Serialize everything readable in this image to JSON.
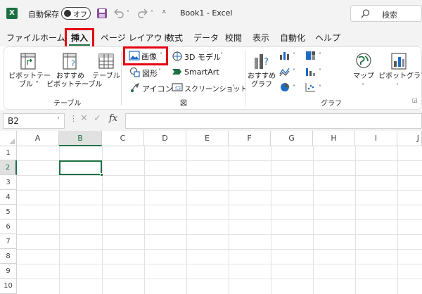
{
  "titlebar": {
    "logo": "X",
    "autosave_label": "自動保存",
    "autosave_state": "オフ",
    "doc_title": "Book1 - Excel",
    "search_placeholder": "検索"
  },
  "tabs": [
    "ファイル",
    "ホーム",
    "挿入",
    "ページ レイアウト",
    "数式",
    "データ",
    "校閲",
    "表示",
    "自動化",
    "ヘルプ"
  ],
  "ribbon": {
    "pivot_table": "ピボットテー\nブル ˅",
    "recommended_pivot": "おすすめ\nピボットテーブル",
    "table": "テーブル",
    "group_table": "テーブル",
    "image": "画像",
    "shapes": "図形",
    "icons": "アイコン",
    "model3d": "3D モデル",
    "smartart": "SmartArt",
    "screenshot": "スクリーンショット",
    "group_figure": "図",
    "recommended_chart": "おすすめ\nグラフ",
    "map": "マップ",
    "pivot_chart": "ピボットグラフ",
    "group_chart": "グラフ"
  },
  "formula_bar": {
    "name_box": "B2",
    "fx": "fx"
  },
  "columns": [
    "A",
    "B",
    "C",
    "D",
    "E",
    "F",
    "G",
    "H",
    "I",
    "J"
  ],
  "rows": [
    "1",
    "2",
    "3",
    "4",
    "5",
    "6",
    "7",
    "8",
    "9",
    "10"
  ],
  "colors": {
    "excel_green": "#1d6f42",
    "highlight_red": "#e60012",
    "selection": "#1e7145"
  }
}
